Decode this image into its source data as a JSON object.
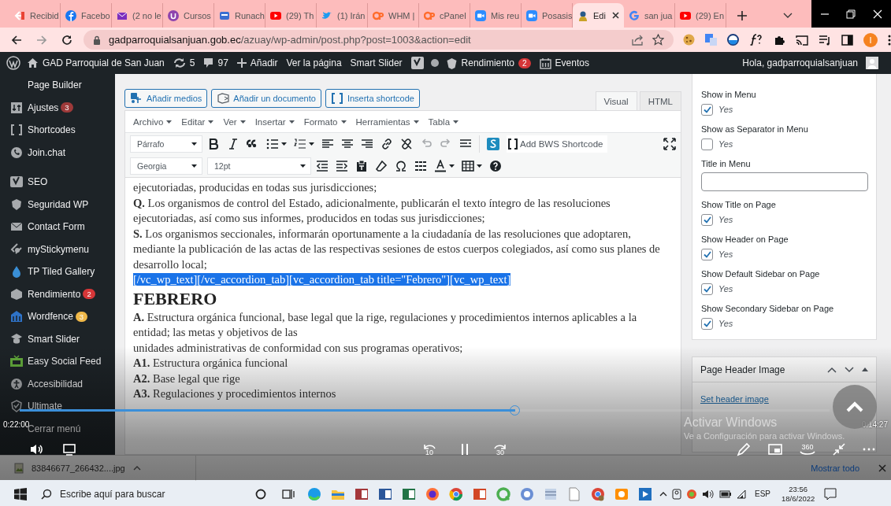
{
  "browser": {
    "tabs": [
      {
        "label": "Recibid",
        "selected": false
      },
      {
        "label": "Facebo",
        "selected": false
      },
      {
        "label": "(2 no le",
        "selected": false
      },
      {
        "label": "Cursos",
        "selected": false
      },
      {
        "label": "Runach",
        "selected": false
      },
      {
        "label": "(29) Th",
        "selected": false
      },
      {
        "label": "(1) Irán",
        "selected": false
      },
      {
        "label": "WHM |",
        "selected": false
      },
      {
        "label": "cPanel",
        "selected": false
      },
      {
        "label": "Mis reu",
        "selected": false
      },
      {
        "label": "Posasis",
        "selected": false
      },
      {
        "label": "Edi",
        "selected": true
      },
      {
        "label": "san jua",
        "selected": false
      },
      {
        "label": "(29) En",
        "selected": false
      }
    ],
    "url_host": "gadparroquialsanjuan.gob.ec",
    "url_path": "/azuay/wp-admin/post.php?post=1003&action=edit",
    "profile_initial": "I"
  },
  "admin_bar": {
    "site": "GAD Parroquial de San Juan",
    "updates": "5",
    "comments": "97",
    "new": "Añadir",
    "view": "Ver la página",
    "slider": "Smart Slider",
    "performance": "Rendimiento",
    "performance_badge": "2",
    "events": "Eventos",
    "greeting": "Hola, gadparroquialsanjuan"
  },
  "sidebar": {
    "groups": [
      {
        "items": [
          {
            "label": "Page Builder"
          },
          {
            "label": "Ajustes",
            "badge": "3",
            "color": "#9e3a3a"
          },
          {
            "label": "Shortcodes"
          },
          {
            "label": "Join.chat"
          }
        ]
      },
      {
        "items": [
          {
            "label": "SEO"
          },
          {
            "label": "Seguridad WP"
          },
          {
            "label": "Contact Form"
          },
          {
            "label": "myStickymenu"
          },
          {
            "label": "TP Tiled Gallery"
          },
          {
            "label": "Rendimiento",
            "badge": "2",
            "color": "#d63638"
          },
          {
            "label": "Wordfence",
            "badge": "3",
            "color": "#f0b849"
          },
          {
            "label": "Smart Slider"
          },
          {
            "label": "Easy Social Feed"
          },
          {
            "label": "Accesibilidad"
          },
          {
            "label": "Ultimate"
          },
          {
            "label": "Cerrar menú"
          }
        ]
      }
    ]
  },
  "editor": {
    "media_buttons": [
      "Añadir medios",
      "Añadir un documento",
      "Inserta shortcode"
    ],
    "mode_tabs": [
      {
        "label": "Visual",
        "selected": true
      },
      {
        "label": "HTML",
        "selected": false
      }
    ],
    "menu": [
      "Archivo",
      "Editar",
      "Ver",
      "Insertar",
      "Formato",
      "Herramientas",
      "Tabla"
    ],
    "format_select": "Párrafo",
    "font_select": "Georgia",
    "size_select": "12pt",
    "shortcode_button": "Add BWS Shortcode",
    "blocks": [
      {
        "kind": "text",
        "lines": [
          {
            "text": "ejecutoriadas, producidas en todas sus jurisdicciones;",
            "highlighted": false
          },
          {
            "text": "**Q.** Los organismos de control del Estado, adicionalmente, publicarán el texto íntegro de las resoluciones",
            "highlighted": false
          },
          {
            "text": "ejecutoriadas, así como sus informes, producidos en todas sus jurisdicciones;",
            "highlighted": false
          },
          {
            "text": "**S.** Los organismos seccionales, informarán oportunamente a la ciudadanía de las resoluciones que adoptaren,",
            "highlighted": false
          },
          {
            "text": "mediante la publicación de las actas de las respectivas sesiones de estos cuerpos colegiados, así como sus planes de",
            "highlighted": false
          },
          {
            "text": "desarrollo local;",
            "highlighted": false
          },
          {
            "text": "[/vc_wp_text][/vc_accordion_tab][vc_accordion_tab title=\"Febrero\"][vc_wp_text]",
            "highlighted": true
          }
        ]
      },
      {
        "kind": "heading",
        "lines": [
          {
            "text": "FEBRERO",
            "highlighted": false
          }
        ]
      },
      {
        "kind": "text",
        "lines": [
          {
            "text": "**A.** Estructura orgánica funcional, base legal que la rige, regulaciones y procedimientos internos aplicables a la",
            "highlighted": false
          },
          {
            "text": "entidad; las metas y objetivos de las",
            "highlighted": false
          },
          {
            "text": "unidades administrativas de conformidad con sus programas operativos;",
            "highlighted": false
          }
        ]
      },
      {
        "kind": "text",
        "lines": [
          {
            "text": "**A1.** Estructura orgánica funcional",
            "highlighted": false
          },
          {
            "text": "**A2.** Base legal que rige",
            "highlighted": false
          },
          {
            "text": "**A3.** Regulaciones y procedimientos internos",
            "highlighted": false
          }
        ]
      }
    ]
  },
  "options_panel": {
    "fields": [
      {
        "kind": "checkbox",
        "label": "Show in Menu",
        "option": "Yes",
        "checked": true
      },
      {
        "kind": "checkbox",
        "label": "Show as Separator in Menu",
        "option": "Yes",
        "checked": false
      },
      {
        "kind": "text_input",
        "label": "Title in Menu"
      },
      {
        "kind": "checkbox",
        "label": "Show Title on Page",
        "option": "Yes",
        "checked": true
      },
      {
        "kind": "checkbox",
        "label": "Show Header on Page",
        "option": "Yes",
        "checked": true
      },
      {
        "kind": "checkbox",
        "label": "Show Default Sidebar on Page",
        "option": "Yes",
        "checked": true
      },
      {
        "kind": "checkbox",
        "label": "Show Secondary Sidebar on Page",
        "option": "Yes",
        "checked": true
      }
    ]
  },
  "header_image_box": {
    "title": "Page Header Image",
    "link": "Set header image"
  },
  "video_player": {
    "elapsed": "0:22:00",
    "remaining": "0:14:27",
    "progress": {
      "level": 0.612
    },
    "rewind": "10",
    "forward": "30",
    "vr": "360"
  },
  "windows_notice": {
    "title": "Activar Windows",
    "subtitle": "Ve a Configuración para activar Windows."
  },
  "download_bar": {
    "file": "83846677_266432....jpg",
    "show_all": "Mostrar todo"
  },
  "taskbar": {
    "search_placeholder": "Escribe aquí para buscar",
    "language": "ESP",
    "time": "23:56",
    "date": "18/6/2022"
  }
}
